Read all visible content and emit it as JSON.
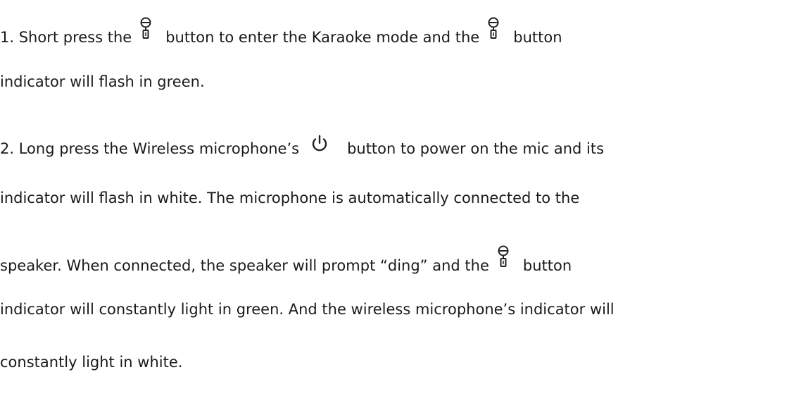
{
  "steps": [
    {
      "line1_a": "1.  Short press the",
      "line1_b": "button to enter the Karaoke mode and the",
      "line1_c": "button",
      "line2": "indicator will flash in green."
    },
    {
      "line1_a": "2.  Long press the Wireless microphone’s",
      "line1_b": "button to power on the mic and its",
      "line2": "indicator will flash in white. The microphone is automatically connected to the",
      "line3_a": "speaker. When connected, the speaker will prompt “ding” and the",
      "line3_b": "button",
      "line4": "indicator will constantly light in green. And the wireless microphone’s indicator will",
      "line5": "constantly light in white."
    }
  ],
  "icons": {
    "mic": "microphone-icon",
    "power": "power-icon"
  }
}
